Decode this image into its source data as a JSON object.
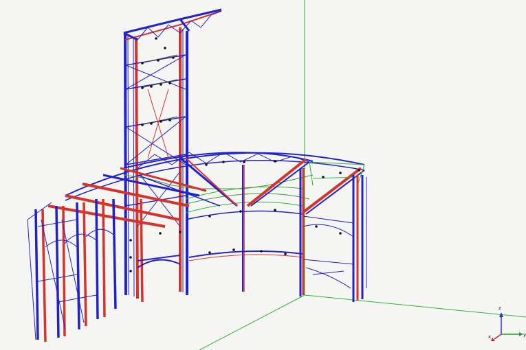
{
  "viewport": {
    "background": "#f5f5f3",
    "colors": {
      "member_blue": "#2222cc",
      "member_red": "#d8332a",
      "ground_green": "#2db52d",
      "brace_green": "#3a9a3a",
      "node_black": "#111111"
    }
  },
  "axes_triad": {
    "icon": "xyz-axis-triad-icon",
    "x_label": "x",
    "y_label": "y",
    "z_label": "z",
    "x_color": "#cc2222",
    "y_color": "#2a9a2a",
    "z_color": "#2233cc"
  }
}
